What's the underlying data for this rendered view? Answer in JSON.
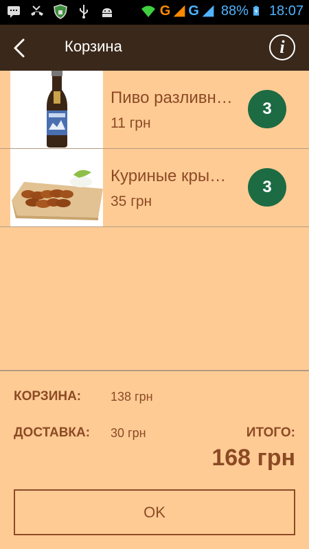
{
  "status_bar": {
    "battery_percent": "88%",
    "time": "18:07",
    "network_1": "G",
    "network_2": "G",
    "icons": [
      "message-icon",
      "missed-call-icon",
      "shield-icon",
      "usb-icon",
      "android-icon",
      "wifi-icon",
      "signal-icon",
      "battery-charging-icon"
    ]
  },
  "header": {
    "title": "Корзина"
  },
  "cart": {
    "items": [
      {
        "name": "Пиво разливн…",
        "price": "11 грн",
        "quantity": "3",
        "image": "beer-bottle"
      },
      {
        "name": "Куриные кры…",
        "price": "35 грн",
        "quantity": "3",
        "image": "chicken-wings"
      }
    ]
  },
  "summary": {
    "cart_label": "КОРЗИНА:",
    "cart_value": "138 грн",
    "delivery_label": "ДОСТАВКА:",
    "delivery_value": "30 грн",
    "total_label": "ИТОГО:",
    "total_value": "168 грн"
  },
  "actions": {
    "ok_label": "OK"
  },
  "colors": {
    "background": "#ffcb95",
    "header": "#3a281a",
    "text": "#8c4a24",
    "badge": "#1d6b43"
  }
}
